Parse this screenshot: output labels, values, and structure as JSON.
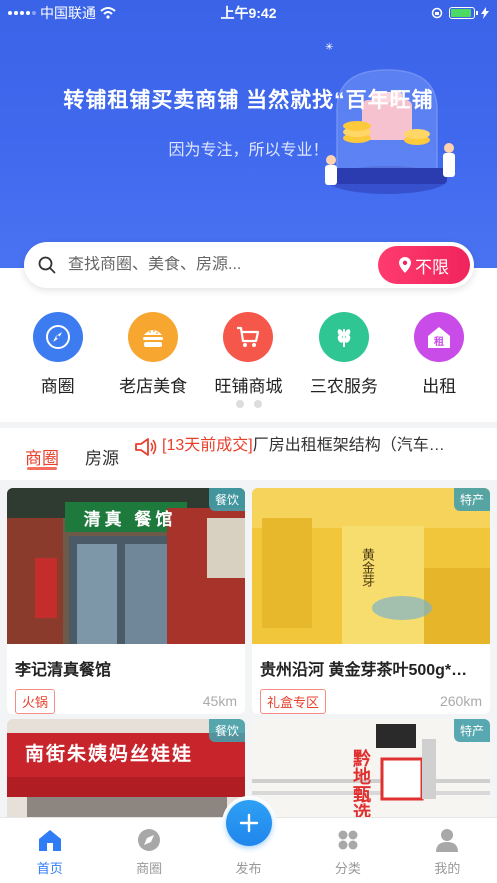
{
  "status_bar": {
    "carrier": "中国联通",
    "time": "上午9:42",
    "battery_level": 0.9
  },
  "banner": {
    "title": "转铺租铺买卖商铺 当然就找“百年旺铺",
    "subtitle": "因为专注，所以专业！"
  },
  "search": {
    "placeholder": "查找商圈、美食、房源...",
    "location_label": "不限"
  },
  "categories": [
    {
      "label": "商圈",
      "icon": "compass-icon",
      "color": "#3c7cf0"
    },
    {
      "label": "老店美食",
      "icon": "burger-icon",
      "color": "#f7a630"
    },
    {
      "label": "旺铺商城",
      "icon": "cart-icon",
      "color": "#f5574a"
    },
    {
      "label": "三农服务",
      "icon": "wheat-icon",
      "color": "#2fc693"
    },
    {
      "label": "出租",
      "icon": "rent-house-icon",
      "color": "#c94ce8",
      "badge": "租"
    }
  ],
  "carousel": {
    "page_count": 2
  },
  "tabs": [
    {
      "label": "商圈"
    },
    {
      "label": "房源"
    }
  ],
  "ticker": {
    "date": "[13天前成交]",
    "text": "厂房出租框架结构（汽车…"
  },
  "cards": [
    {
      "tag": "餐饮",
      "title": "李记清真餐馆",
      "badge": "火锅",
      "distance": "45km",
      "img_sign": "清真 餐馆"
    },
    {
      "tag": "特产",
      "title": "贵州沿河 黄金芽茶叶500g*…",
      "badge": "礼盒专区",
      "distance": "260km",
      "img_sign": "黄金芽"
    },
    {
      "tag": "餐饮",
      "img_sign": "南街朱姨妈丝娃娃"
    },
    {
      "tag": "特产",
      "img_sign": "黔地甄选"
    }
  ],
  "bottom_nav": [
    {
      "label": "首页",
      "icon": "home-icon"
    },
    {
      "label": "商圈",
      "icon": "compass-icon"
    },
    {
      "label": "发布",
      "icon": "plus-icon"
    },
    {
      "label": "分类",
      "icon": "grid-icon"
    },
    {
      "label": "我的",
      "icon": "user-icon"
    }
  ],
  "colors": {
    "accent": "#e8402c",
    "primary_blue": "#3a63e8",
    "nav_active": "#2f7df6"
  }
}
